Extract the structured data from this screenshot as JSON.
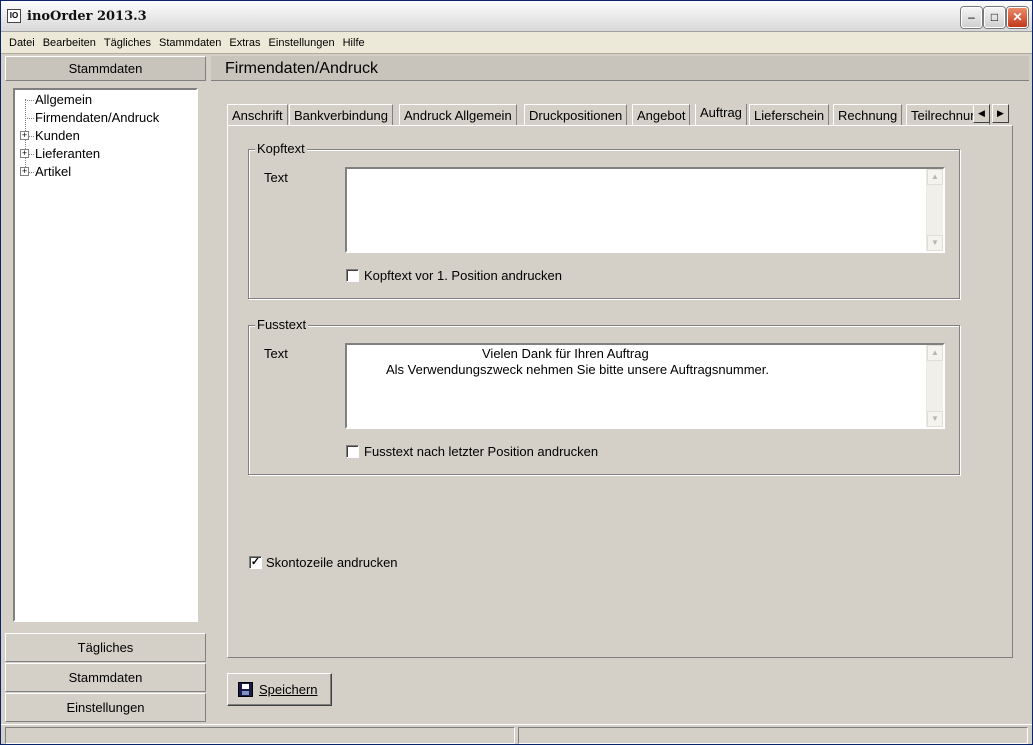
{
  "window": {
    "title": "inoOrder 2013.3",
    "app_icon_text": "IO"
  },
  "menu": [
    "Datei",
    "Bearbeiten",
    "Tägliches",
    "Stammdaten",
    "Extras",
    "Einstellungen",
    "Hilfe"
  ],
  "left_panel": {
    "header": "Stammdaten",
    "tree": [
      {
        "label": "Allgemein",
        "expandable": false
      },
      {
        "label": "Firmendaten/Andruck",
        "expandable": false
      },
      {
        "label": "Kunden",
        "expandable": true
      },
      {
        "label": "Lieferanten",
        "expandable": true
      },
      {
        "label": "Artikel",
        "expandable": true
      }
    ],
    "buttons": [
      "Tägliches",
      "Stammdaten",
      "Einstellungen"
    ]
  },
  "main": {
    "header": "Firmendaten/Andruck",
    "tabs": [
      "Anschrift",
      "Bankverbindung",
      "Andruck Allgemein",
      "Druckpositionen",
      "Angebot",
      "Auftrag",
      "Lieferschein",
      "Rechnung",
      "Teilrechnung"
    ],
    "active_tab": "Auftrag",
    "kopftext": {
      "group_label": "Kopftext",
      "field_label": "Text",
      "lines": [],
      "checkbox_label": "Kopftext vor 1. Position andrucken",
      "checked": false
    },
    "fusstext": {
      "group_label": "Fusstext",
      "field_label": "Text",
      "lines": [
        "Vielen Dank für Ihren Auftrag",
        "Als Verwendungszweck nehmen Sie bitte unsere Auftragsnummer."
      ],
      "checkbox_label": "Fusstext nach letzter Position andrucken",
      "checked": false
    },
    "skonto": {
      "label": "Skontozeile andrucken",
      "checked": true
    },
    "save_label": "Speichern"
  }
}
